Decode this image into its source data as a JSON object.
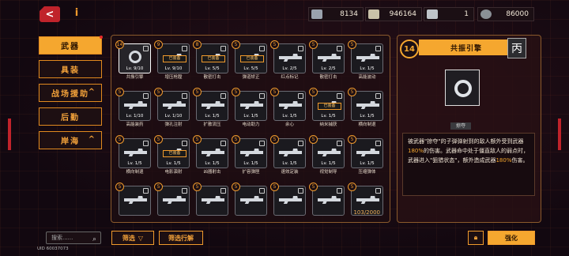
{
  "resources": [
    {
      "icon": "cube-icon",
      "value": "8134"
    },
    {
      "icon": "cash-icon",
      "value": "946164"
    },
    {
      "icon": "ticket-icon",
      "value": "1"
    },
    {
      "icon": "gem-icon",
      "value": "86000"
    }
  ],
  "nav": [
    {
      "label": "武器",
      "active": true
    },
    {
      "label": "具装",
      "active": false
    },
    {
      "label": "战场援助",
      "active": false,
      "chevron": "^"
    },
    {
      "label": "后勤",
      "active": false
    },
    {
      "label": "岸海",
      "active": false,
      "chevron": "^"
    }
  ],
  "items": [
    {
      "badge": "14",
      "tag": "",
      "lv": "Lv. 9/10",
      "name": "共振引擎",
      "sel": true,
      "icon": "gear"
    },
    {
      "badge": "9",
      "tag": "已装备",
      "lv": "Lv. 9/10",
      "name": "增压枪膛",
      "sel": false,
      "icon": "gun"
    },
    {
      "badge": "8",
      "tag": "已装备",
      "lv": "Lv. 5/5",
      "name": "散密打击",
      "sel": false,
      "icon": "gun"
    },
    {
      "badge": "5",
      "tag": "已装备",
      "lv": "Lv. 5/5",
      "name": "弹道矫正",
      "sel": false,
      "icon": "gun"
    },
    {
      "badge": "5",
      "tag": "",
      "lv": "Lv. 2/5",
      "name": "红点标记",
      "sel": false,
      "icon": "gun"
    },
    {
      "badge": "5",
      "tag": "",
      "lv": "Lv. 2/5",
      "name": "散密打击",
      "sel": false,
      "icon": "gun"
    },
    {
      "badge": "5",
      "tag": "",
      "lv": "Lv. 1/5",
      "name": "高能波动",
      "sel": false,
      "icon": "gun"
    },
    {
      "badge": "5",
      "tag": "",
      "lv": "Lv. 1/10",
      "name": "高能装药",
      "sel": false,
      "icon": "gun"
    },
    {
      "badge": "5",
      "tag": "",
      "lv": "Lv. 1/10",
      "name": "弹孔注射",
      "sel": false,
      "icon": "gun"
    },
    {
      "badge": "5",
      "tag": "",
      "lv": "Lv. 1/5",
      "name": "扩散流压",
      "sel": false,
      "icon": "gun"
    },
    {
      "badge": "5",
      "tag": "",
      "lv": "Lv. 1/5",
      "name": "电动助力",
      "sel": false,
      "icon": "gun"
    },
    {
      "badge": "5",
      "tag": "",
      "lv": "Lv. 1/5",
      "name": "余心",
      "sel": false,
      "icon": "gun"
    },
    {
      "badge": "5",
      "tag": "已装备",
      "lv": "Lv. 1/5",
      "name": "纳米捕获",
      "sel": false,
      "icon": "gun"
    },
    {
      "badge": "5",
      "tag": "",
      "lv": "Lv. 1/5",
      "name": "横向制退",
      "sel": false,
      "icon": "gun"
    },
    {
      "badge": "5",
      "tag": "",
      "lv": "Lv. 1/5",
      "name": "横向制退",
      "sel": false,
      "icon": "gun"
    },
    {
      "badge": "5",
      "tag": "已装备",
      "lv": "Lv. 1/5",
      "name": "电影演射",
      "sel": false,
      "icon": "gun"
    },
    {
      "badge": "5",
      "tag": "",
      "lv": "Lv. 1/5",
      "name": "凶器射击",
      "sel": false,
      "icon": "gun"
    },
    {
      "badge": "5",
      "tag": "",
      "lv": "Lv. 1/5",
      "name": "扩容弹匣",
      "sel": false,
      "icon": "gun"
    },
    {
      "badge": "5",
      "tag": "",
      "lv": "Lv. 1/5",
      "name": "速效定装",
      "sel": false,
      "icon": "gun"
    },
    {
      "badge": "5",
      "tag": "",
      "lv": "Lv. 1/5",
      "name": "视觉制导",
      "sel": false,
      "icon": "gun"
    },
    {
      "badge": "5",
      "tag": "",
      "lv": "Lv. 1/5",
      "name": "压缩弹体",
      "sel": false,
      "icon": "gun"
    },
    {
      "badge": "5",
      "tag": "",
      "lv": "",
      "name": "",
      "sel": false,
      "icon": "gun"
    },
    {
      "badge": "5",
      "tag": "",
      "lv": "",
      "name": "",
      "sel": false,
      "icon": "gun"
    },
    {
      "badge": "5",
      "tag": "",
      "lv": "",
      "name": "",
      "sel": false,
      "icon": "gun"
    },
    {
      "badge": "5",
      "tag": "",
      "lv": "",
      "name": "",
      "sel": false,
      "icon": "gun"
    },
    {
      "badge": "5",
      "tag": "",
      "lv": "",
      "name": "",
      "sel": false,
      "icon": "gun"
    },
    {
      "badge": "5",
      "tag": "",
      "lv": "",
      "name": "",
      "sel": false,
      "icon": "gun"
    },
    {
      "badge": "5",
      "tag": "",
      "lv": "",
      "name": "",
      "sel": false,
      "icon": "gun"
    }
  ],
  "count": "103/2000",
  "detail": {
    "number": "14",
    "title": "共振引擎",
    "tag": "掠夺",
    "desc_1": "被武器\"掠夺\"的子弹弹射到的敌人额外受到武器",
    "desc_hl1": "180%",
    "desc_2": "的伤害。武器命中处于僵直敌人的弱点时，武器进入\"狙猎状态\"，额外造成武器",
    "desc_hl2": "180%",
    "desc_3": "伤害。"
  },
  "bottom": {
    "search_placeholder": "搜索......",
    "filter": "筛选",
    "sort": "筛选行解",
    "upgrade": "强化",
    "uid": "UID 60037073"
  }
}
